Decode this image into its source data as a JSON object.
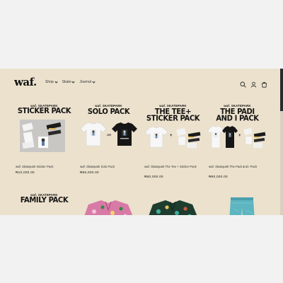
{
  "header": {
    "logo": "waf.",
    "nav": [
      {
        "label": "Shop"
      },
      {
        "label": "Skate"
      },
      {
        "label": "Journal"
      }
    ]
  },
  "products": [
    {
      "brand": "waf. SKATEPARK",
      "headline": [
        "STICKER PACK"
      ],
      "name": "waf. Skatepark Sticker Pack",
      "price": "₦10,000.00"
    },
    {
      "brand": "waf. SKATEPARK",
      "headline": [
        "SOLO PACK"
      ],
      "name": "waf. Skatepark Solo Pack",
      "price": "₦65,000.00",
      "connector": "OR"
    },
    {
      "brand": "waf. SKATEPARK",
      "headline": [
        "THE TEE+",
        "STICKER PACK"
      ],
      "name": "waf. Skatepark The Tee + Sticker Pack",
      "price": "₦50,000.00",
      "connector": "+"
    },
    {
      "brand": "waf. SKATEPARK",
      "headline": [
        "THE PADI",
        "AND I PACK"
      ],
      "name": "waf. Skatepark The Padi and I Pack",
      "price": "₦90,000.00",
      "connector": "+"
    }
  ],
  "row2": {
    "brand": "waf. SKATEPARK",
    "headline": "FAMILY PACK"
  },
  "colors": {
    "background": "#ebe1cd",
    "page": "#f3f2f2",
    "text": "#141414"
  }
}
